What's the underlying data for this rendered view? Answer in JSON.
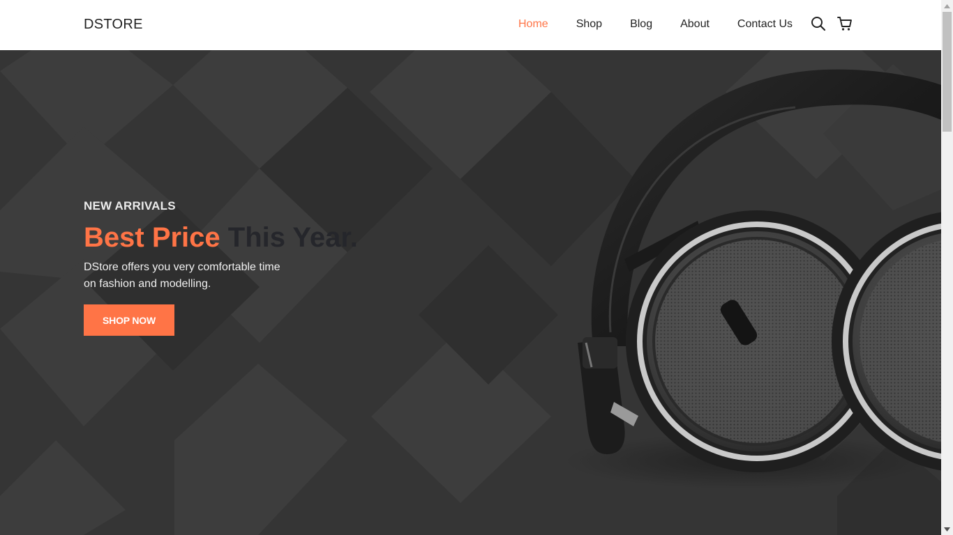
{
  "header": {
    "logo": "DSTORE",
    "nav": [
      {
        "label": "Home",
        "active": true
      },
      {
        "label": "Shop",
        "active": false
      },
      {
        "label": "Blog",
        "active": false
      },
      {
        "label": "About",
        "active": false
      },
      {
        "label": "Contact Us",
        "active": false
      }
    ],
    "icons": [
      "search-icon",
      "cart-icon"
    ]
  },
  "hero": {
    "eyebrow": "NEW ARRIVALS",
    "headline_highlight": "Best Price",
    "headline_rest": "This Year.",
    "description_line1": "DStore offers you very comfortable time",
    "description_line2": "on fashion and modelling.",
    "cta_label": "SHOP NOW"
  },
  "colors": {
    "accent": "#ff7446",
    "hero_background": "#363636",
    "headline_dark": "#25262b"
  }
}
